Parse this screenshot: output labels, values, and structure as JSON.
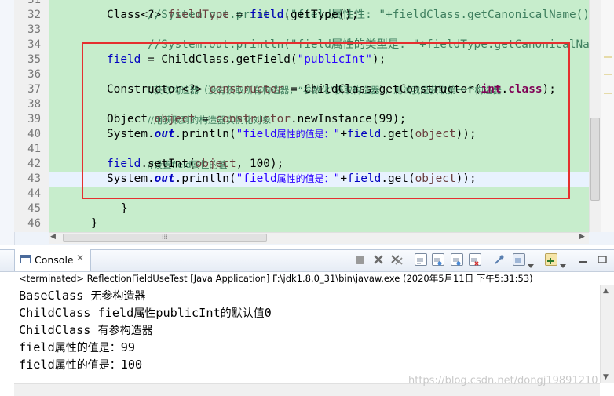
{
  "editor": {
    "line_numbers": [
      "31",
      "32",
      "33",
      "34",
      "35",
      "36",
      "37",
      "38",
      "39",
      "40",
      "41",
      "42",
      "43",
      "44",
      "45",
      "46"
    ]
  },
  "code": {
    "l31": {
      "a": "//System.out.println(\"field属性性: \"+fieldClass.getCanonicalName()+\" 中是"
    },
    "l32": {
      "a": "Class<?> ",
      "b": "fieldType",
      "c": " = ",
      "d": "field",
      "e": ".getType();"
    },
    "l33": {
      "a": "//System.out.println(\"field属性的类型是: \"+fieldType.getCanonicalName());"
    },
    "l35": {
      "a": "field",
      "b": " = ChildClass.getField(",
      "c": "\"publicInt\"",
      "d": ");"
    },
    "l36": {
      "a": "//获取构造器（没有获取所有构造器，“参数化”获取构造器），测试我是获取第一个构造器"
    },
    "l37": {
      "a": "Constructor<?> ",
      "b": "constructor",
      "c": " = ChildClass.getConstructor(",
      "d": "int",
      "e": ".",
      "f": "class",
      "g": ");"
    },
    "l38": {
      "a": "//用获取到的构造器实例化对象"
    },
    "l39": {
      "a": "Object ",
      "b": "object",
      "c": " = ",
      "d": "constructor",
      "e": ".newInstance(99);"
    },
    "l40": {
      "a": "System.",
      "b": "out",
      "c": ".println(",
      "d": "\"field",
      "e": "属性的值是：",
      "f": "\"",
      "g": "+",
      "h": "field",
      "i": ".get(",
      "j": "object",
      "k": "));"
    },
    "l41": {
      "a": "//设置field属性的值"
    },
    "l42": {
      "a": "field",
      "b": ".setInt(",
      "c": "object",
      "d": ", 100);"
    },
    "l43": {
      "a": "System.",
      "b": "out",
      "c": ".println(",
      "d": "\"field",
      "e": "属性的值是：",
      "f": "\"",
      "g": "+",
      "h": "field",
      "i": ".get(",
      "j": "object",
      "k": "));"
    },
    "l44": {
      "a": "}"
    },
    "l45": {
      "a": "}"
    }
  },
  "console": {
    "tab_label": "Console",
    "close_glyph": "✕",
    "status": "<terminated> ReflectionFieldUseTest [Java Application] F:\\jdk1.8.0_31\\bin\\javaw.exe (2020年5月11日 下午5:31:53)",
    "output": [
      {
        "a": "BaseClass ",
        "b": "无参构造器"
      },
      {
        "a": "ChildClass field",
        "b": "属性",
        "c": "publicInt",
        "d": "的默认值",
        "e": "0"
      },
      {
        "a": "ChildClass ",
        "b": "有参构造器"
      },
      {
        "a": "field",
        "b": "属性的值是：",
        "c": "99"
      },
      {
        "a": "field",
        "b": "属性的值是：",
        "c": "100"
      }
    ],
    "watermark": "https://blog.csdn.net/dongj19891210"
  },
  "icons": {
    "toolbar": [
      "terminate-icon",
      "remove-launch-icon",
      "remove-all-icon",
      "scroll-lock-icon",
      "show-stdout-icon",
      "show-stderr-icon",
      "word-wrap-icon",
      "pin-console-icon",
      "display-console-icon",
      "open-console-icon",
      "view-menu-icon"
    ]
  },
  "colors": {
    "highlight_box": "#e52f2f",
    "editor_bg": "#c7edcc",
    "keyword": "#7f0055",
    "comment": "#3f7f5f",
    "string": "#2a00ff",
    "field": "#0000c0"
  }
}
